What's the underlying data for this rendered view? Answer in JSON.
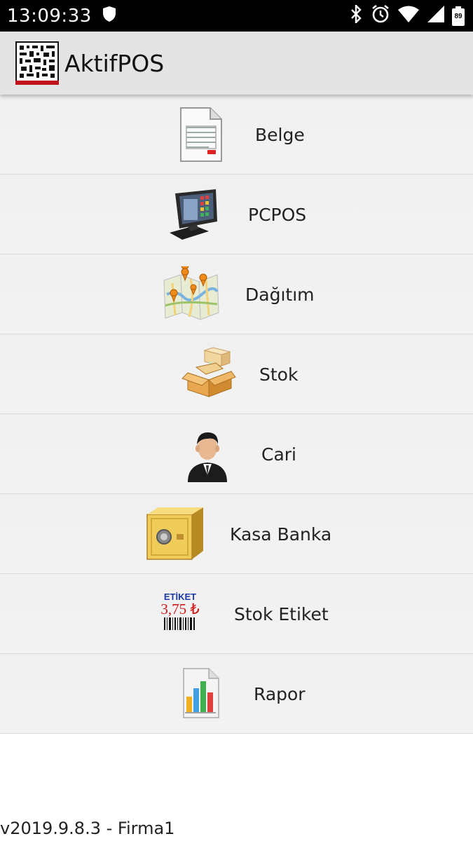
{
  "status_bar": {
    "time": "13:09:33",
    "battery": "89",
    "icons": [
      "shield-icon",
      "bluetooth-icon",
      "alarm-icon",
      "wifi-icon",
      "signal-icon",
      "battery-icon"
    ]
  },
  "app_bar": {
    "title": "AktifPOS",
    "logo_icon": "barcode-logo-icon"
  },
  "menu": {
    "items": [
      {
        "label": "Belge",
        "icon": "document-icon"
      },
      {
        "label": "PCPOS",
        "icon": "pos-terminal-icon"
      },
      {
        "label": "Dağıtım",
        "icon": "map-icon"
      },
      {
        "label": "Stok",
        "icon": "boxes-icon"
      },
      {
        "label": "Cari",
        "icon": "person-icon"
      },
      {
        "label": "Kasa Banka",
        "icon": "safe-icon"
      },
      {
        "label": "Stok Etiket",
        "icon": "label-barcode-icon"
      },
      {
        "label": "Rapor",
        "icon": "report-chart-icon"
      }
    ],
    "etiket_text": "ETİKET",
    "etiket_price": "3,75 ₺"
  },
  "footer": {
    "version": "v2019.9.8.3 - Firma1"
  },
  "colors": {
    "status_bar_bg": "#000000",
    "app_bar_bg": "#e4e4e4",
    "menu_bg": "#f0f0f0"
  }
}
